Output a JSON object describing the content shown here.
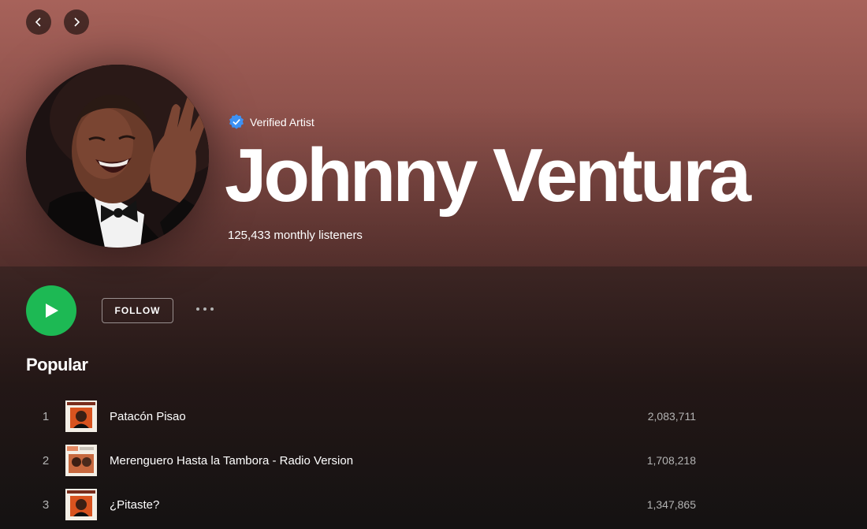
{
  "nav": {
    "back_icon": "chevron-left-icon",
    "forward_icon": "chevron-right-icon"
  },
  "artist": {
    "verified_label": "Verified Artist",
    "name": "Johnny Ventura",
    "monthly_listeners": "125,433 monthly listeners",
    "avatar_icon": "artist-photo"
  },
  "actions": {
    "follow_label": "FOLLOW",
    "play_icon": "play-icon",
    "more_icon": "more-options-icon"
  },
  "popular": {
    "title": "Popular",
    "tracks": [
      {
        "num": "1",
        "title": "Patacón Pisao",
        "plays": "2,083,711"
      },
      {
        "num": "2",
        "title": "Merenguero Hasta la Tambora - Radio Version",
        "plays": "1,708,218"
      },
      {
        "num": "3",
        "title": "¿Pitaste?",
        "plays": "1,347,865"
      }
    ]
  },
  "colors": {
    "accent": "#1db954",
    "hero": "#a7625a",
    "background": "#121212",
    "verified_badge": "#3d91f4"
  }
}
